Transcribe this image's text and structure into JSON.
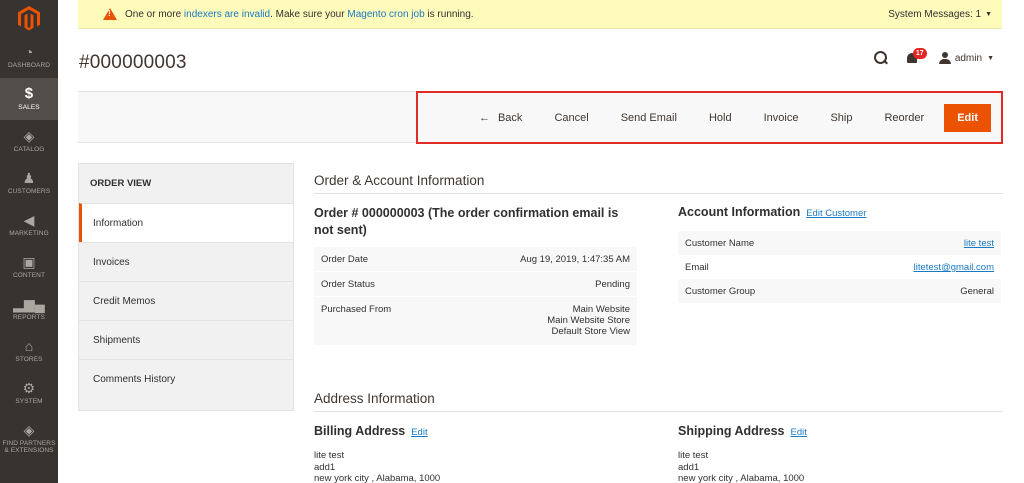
{
  "nav": {
    "items": [
      {
        "label": "DASHBOARD",
        "icon": "dashboard-icon"
      },
      {
        "label": "SALES",
        "icon": "dollar-icon"
      },
      {
        "label": "CATALOG",
        "icon": "cube-icon"
      },
      {
        "label": "CUSTOMERS",
        "icon": "person-icon"
      },
      {
        "label": "MARKETING",
        "icon": "megaphone-icon"
      },
      {
        "label": "CONTENT",
        "icon": "content-icon"
      },
      {
        "label": "REPORTS",
        "icon": "bar-chart-icon"
      },
      {
        "label": "STORES",
        "icon": "store-icon"
      },
      {
        "label": "SYSTEM",
        "icon": "gear-icon"
      },
      {
        "label": "FIND PARTNERS & EXTENSIONS",
        "icon": "partners-icon"
      }
    ],
    "active_index": 1,
    "accent": "#eb5202"
  },
  "system_message": {
    "prefix": "One or more",
    "link1": "indexers are invalid",
    "middle": ". Make sure your",
    "link2": "Magento cron job",
    "suffix": "is running.",
    "count_label": "System Messages: 1"
  },
  "header": {
    "title": "#000000003",
    "notification_count": "17",
    "user": "admin"
  },
  "toolbar": {
    "back": "Back",
    "cancel": "Cancel",
    "send_email": "Send Email",
    "hold": "Hold",
    "invoice": "Invoice",
    "ship": "Ship",
    "reorder": "Reorder",
    "edit": "Edit"
  },
  "side_tabs": {
    "title": "ORDER VIEW",
    "items": [
      "Information",
      "Invoices",
      "Credit Memos",
      "Shipments",
      "Comments History"
    ]
  },
  "order_account": {
    "section_title": "Order & Account Information",
    "order_heading": "Order # 000000003 (The order confirmation email is not sent)",
    "order_rows": [
      {
        "label": "Order Date",
        "value": "Aug 19, 2019, 1:47:35 AM"
      },
      {
        "label": "Order Status",
        "value": "Pending"
      },
      {
        "label": "Purchased From",
        "value_lines": [
          "Main Website",
          "Main Website Store",
          "Default Store View"
        ]
      }
    ],
    "account_heading": "Account Information",
    "edit_customer": "Edit Customer",
    "account_rows": [
      {
        "label": "Customer Name",
        "value": "lite test"
      },
      {
        "label": "Email",
        "value": "litetest@gmail.com"
      },
      {
        "label": "Customer Group",
        "value": "General"
      }
    ]
  },
  "address": {
    "section_title": "Address Information",
    "billing_heading": "Billing Address",
    "shipping_heading": "Shipping Address",
    "edit_label": "Edit",
    "billing_lines": [
      "lite test",
      "add1",
      "new york city , Alabama, 1000"
    ],
    "shipping_lines": [
      "lite test",
      "add1",
      "new york city , Alabama, 1000"
    ]
  }
}
